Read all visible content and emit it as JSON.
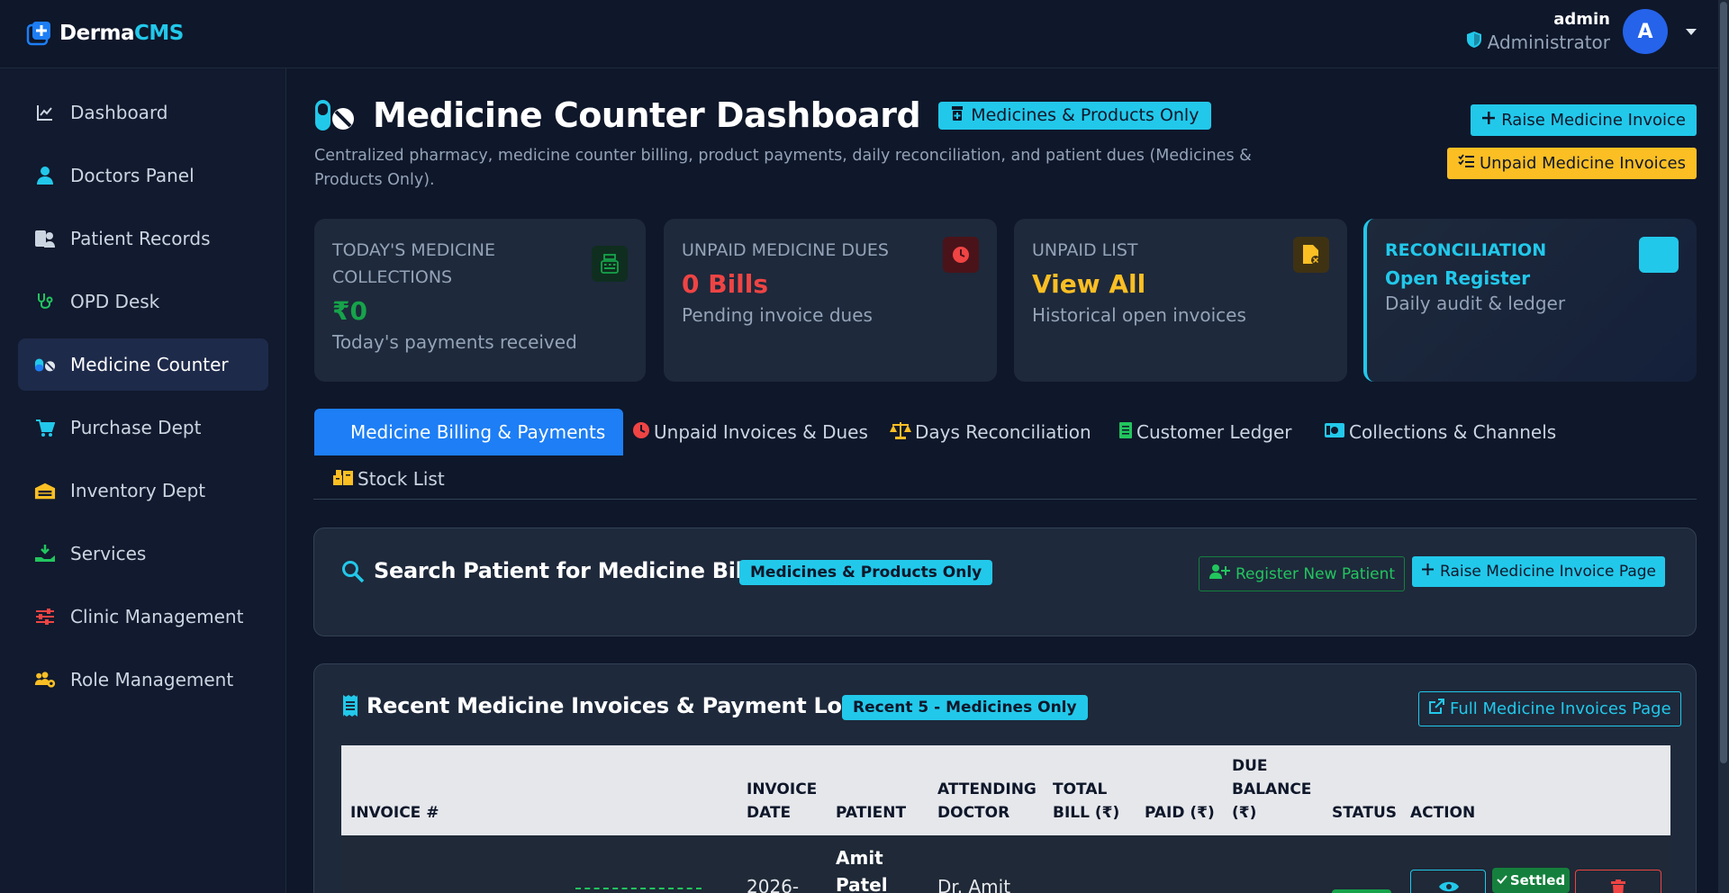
{
  "app": {
    "logo_part1": "Derma",
    "logo_part2": "CMS",
    "brand_color": "#22c8ea"
  },
  "user": {
    "name": "admin",
    "role": "Administrator",
    "avatar_letter": "A",
    "avatar_color": "#2563eb"
  },
  "sidebar": {
    "items": [
      {
        "label": "Dashboard",
        "icon": "chart-line-icon"
      },
      {
        "label": "Doctors Panel",
        "icon": "doctor-icon"
      },
      {
        "label": "Patient Records",
        "icon": "patient-records-icon"
      },
      {
        "label": "OPD Desk",
        "icon": "stethoscope-icon"
      },
      {
        "label": "Medicine Counter",
        "icon": "pills-icon",
        "active": true
      },
      {
        "label": "Purchase Dept",
        "icon": "cart-icon"
      },
      {
        "label": "Inventory Dept",
        "icon": "warehouse-icon"
      },
      {
        "label": "Services",
        "icon": "hand-holding-icon"
      },
      {
        "label": "Clinic Management",
        "icon": "sliders-icon"
      },
      {
        "label": "Role Management",
        "icon": "users-gear-icon"
      }
    ]
  },
  "header": {
    "title": "Medicine Counter Dashboard",
    "badge": "Medicines & Products Only",
    "subtitle": "Centralized pharmacy, medicine counter billing, product payments, daily reconciliation, and patient dues (Medicines & Products Only).",
    "raise_button": "Raise Medicine Invoice",
    "unpaid_button": "Unpaid Medicine Invoices"
  },
  "stats": [
    {
      "label": "TODAY'S MEDICINE COLLECTIONS",
      "value": "₹0",
      "desc": "Today's payments received",
      "value_color": "#16a34a",
      "icon": "cash-register-icon"
    },
    {
      "label": "UNPAID MEDICINE DUES",
      "value": "0 Bills",
      "desc": "Pending invoice dues",
      "value_color": "#ef4444",
      "icon": "clock-icon"
    },
    {
      "label": "UNPAID LIST",
      "value": "View All",
      "desc": "Historical open invoices",
      "value_color": "#fbbf24",
      "icon": "file-invoice-icon"
    },
    {
      "label": "RECONCILIATION",
      "value": "Open Register",
      "desc": "Daily audit & ledger",
      "value_color": "#22c8ea",
      "icon": "register-icon"
    }
  ],
  "tabs": [
    {
      "label": "Medicine Billing & Payments",
      "icon": "billing-icon",
      "active": true
    },
    {
      "label": "Unpaid Invoices & Dues",
      "icon": "clock-icon"
    },
    {
      "label": "Days Reconciliation",
      "icon": "scale-icon"
    },
    {
      "label": "Customer Ledger",
      "icon": "ledger-icon"
    },
    {
      "label": "Collections & Channels",
      "icon": "money-icon"
    },
    {
      "label": "Stock List",
      "icon": "boxes-icon"
    }
  ],
  "search_panel": {
    "title": "Search Patient for Medicine Billing",
    "badge": "Medicines & Products Only",
    "register_button": "Register New Patient",
    "raise_page_button": "Raise Medicine Invoice Page"
  },
  "invoices_panel": {
    "title": "Recent Medicine Invoices & Payment Loggers",
    "badge": "Recent 5 - Medicines Only",
    "full_page_button": "Full Medicine Invoices Page",
    "columns": [
      "INVOICE #",
      "INVOICE DATE",
      "PATIENT",
      "ATTENDING DOCTOR",
      "TOTAL BILL (₹)",
      "PAID (₹)",
      "DUE BALANCE (₹)",
      "STATUS",
      "ACTION"
    ],
    "rows": [
      {
        "date": "2026-",
        "patient": "Amit Patel",
        "doctor": "Dr. Amit",
        "settled_label": "Settled"
      }
    ]
  }
}
